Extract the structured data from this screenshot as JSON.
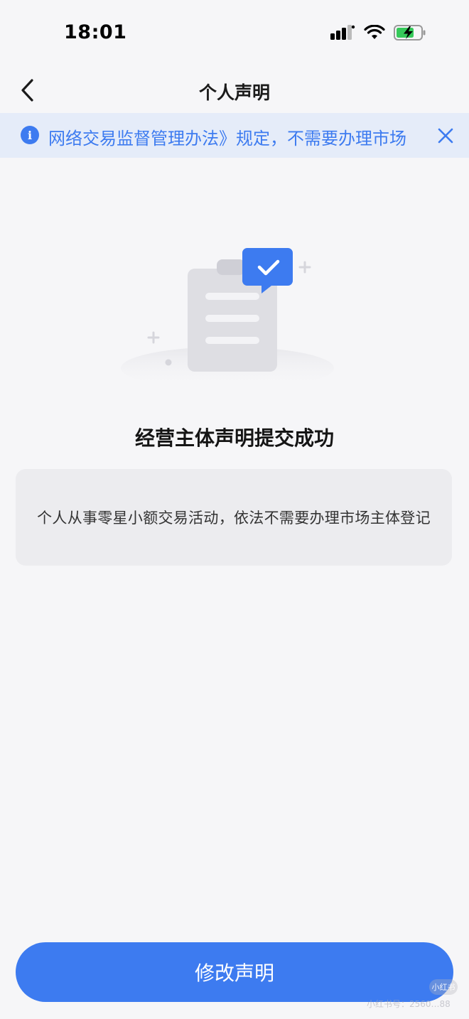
{
  "status_bar": {
    "time": "18:01"
  },
  "nav": {
    "title": "个人声明",
    "back_icon": "chevron-left-icon"
  },
  "notice": {
    "icon": "info-icon",
    "icon_glyph": "i",
    "text": "网络交易监督管理办法》规定，不需要办理市场",
    "close_icon": "close-icon"
  },
  "illustration": {
    "icon": "clipboard-check-icon"
  },
  "result": {
    "title": "经营主体声明提交成功",
    "description": "个人从事零星小额交易活动，依法不需要办理市场主体登记"
  },
  "actions": {
    "modify_label": "修改声明"
  },
  "watermark": {
    "badge": "小红书",
    "text": "小红书号：2560…88"
  },
  "colors": {
    "accent": "#3d7bf0",
    "notice_bg": "#e5ecf9",
    "page_bg": "#f6f6f8",
    "card_bg": "#ececef"
  }
}
